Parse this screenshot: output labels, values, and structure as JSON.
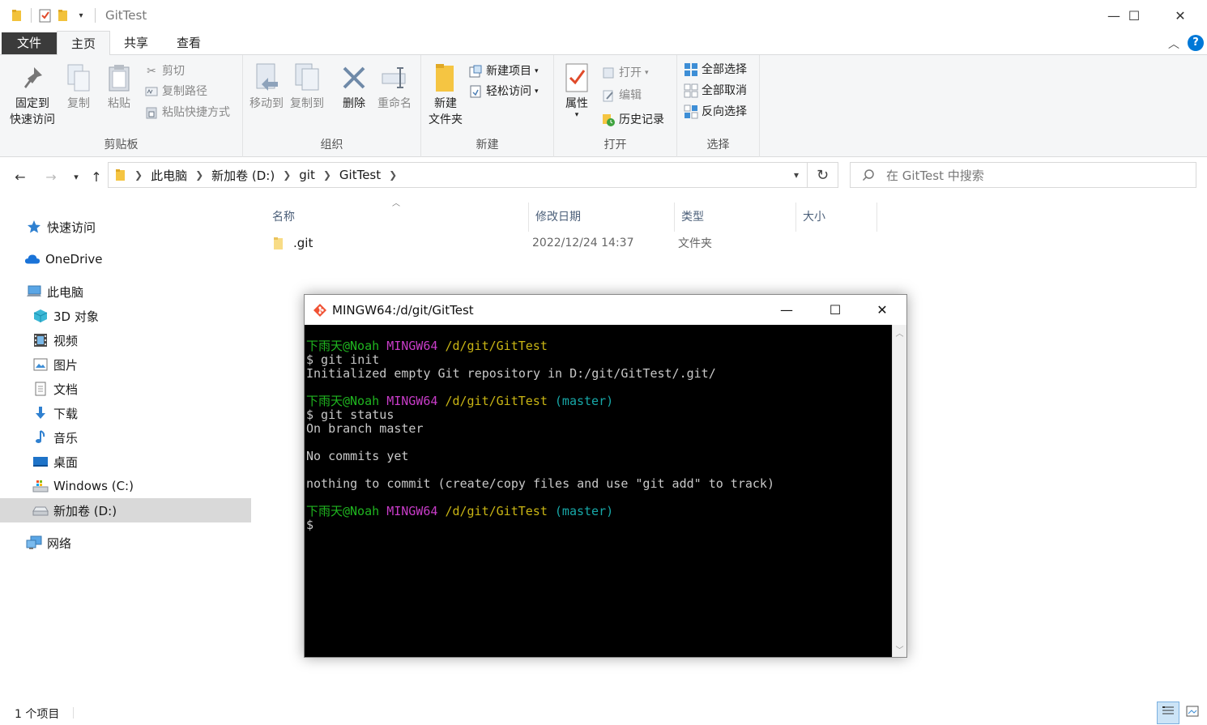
{
  "window": {
    "title": "GitTest",
    "minimize": "—",
    "maximize": "☐",
    "close": "✕"
  },
  "ribbon_tabs": [
    "文件",
    "主页",
    "共享",
    "查看"
  ],
  "ribbon": {
    "clipboard": {
      "label": "剪贴板",
      "pin_line1": "固定到",
      "pin_line2": "快速访问",
      "copy": "复制",
      "paste": "粘贴",
      "cut": "剪切",
      "copy_path": "复制路径",
      "paste_shortcut": "粘贴快捷方式"
    },
    "organize": {
      "label": "组织",
      "move_to": "移动到",
      "copy_to": "复制到",
      "delete": "删除",
      "rename": "重命名"
    },
    "new": {
      "label": "新建",
      "new_folder_line1": "新建",
      "new_folder_line2": "文件夹",
      "new_item": "新建项目",
      "easy_access": "轻松访问"
    },
    "open": {
      "label": "打开",
      "properties": "属性",
      "open": "打开",
      "edit": "编辑",
      "history": "历史记录"
    },
    "select": {
      "label": "选择",
      "select_all": "全部选择",
      "select_none": "全部取消",
      "invert": "反向选择"
    }
  },
  "address": {
    "crumbs": [
      "此电脑",
      "新加卷 (D:)",
      "git",
      "GitTest"
    ],
    "search_placeholder": "在 GitTest 中搜索"
  },
  "sidebar": {
    "items": [
      {
        "label": "快速访问",
        "icon": "star-icon"
      },
      {
        "label": "OneDrive",
        "icon": "cloud-icon"
      },
      {
        "label": "此电脑",
        "icon": "computer-icon"
      },
      {
        "label": "3D 对象",
        "icon": "cube-icon"
      },
      {
        "label": "视频",
        "icon": "film-icon"
      },
      {
        "label": "图片",
        "icon": "picture-icon"
      },
      {
        "label": "文档",
        "icon": "document-icon"
      },
      {
        "label": "下载",
        "icon": "download-icon"
      },
      {
        "label": "音乐",
        "icon": "music-icon"
      },
      {
        "label": "桌面",
        "icon": "desktop-icon"
      },
      {
        "label": "Windows (C:)",
        "icon": "drive-icon"
      },
      {
        "label": "新加卷 (D:)",
        "icon": "drive-icon",
        "selected": true
      },
      {
        "label": "网络",
        "icon": "network-icon"
      }
    ]
  },
  "columns": [
    "名称",
    "修改日期",
    "类型",
    "大小"
  ],
  "files": [
    {
      "name": ".git",
      "modified": "2022/12/24 14:37",
      "type": "文件夹",
      "size": ""
    }
  ],
  "status": {
    "count": "1 个项目"
  },
  "terminal": {
    "title": "MINGW64:/d/git/GitTest",
    "user": "下雨天@Noah",
    "env": "MINGW64",
    "path": "/d/git/GitTest",
    "branch": "(master)",
    "cmd1": "$ git init",
    "out1": "Initialized empty Git repository in D:/git/GitTest/.git/",
    "cmd2": "$ git status",
    "out2a": "On branch master",
    "out2b": "No commits yet",
    "out2c": "nothing to commit (create/copy files and use \"git add\" to track)",
    "prompt": "$"
  },
  "colors": {
    "accent": "#0078d7",
    "folder": "#f5c542",
    "term_green": "#1fb51f",
    "term_magenta": "#c83cc8",
    "term_yellow": "#c9b514",
    "term_cyan": "#17a8a8"
  }
}
